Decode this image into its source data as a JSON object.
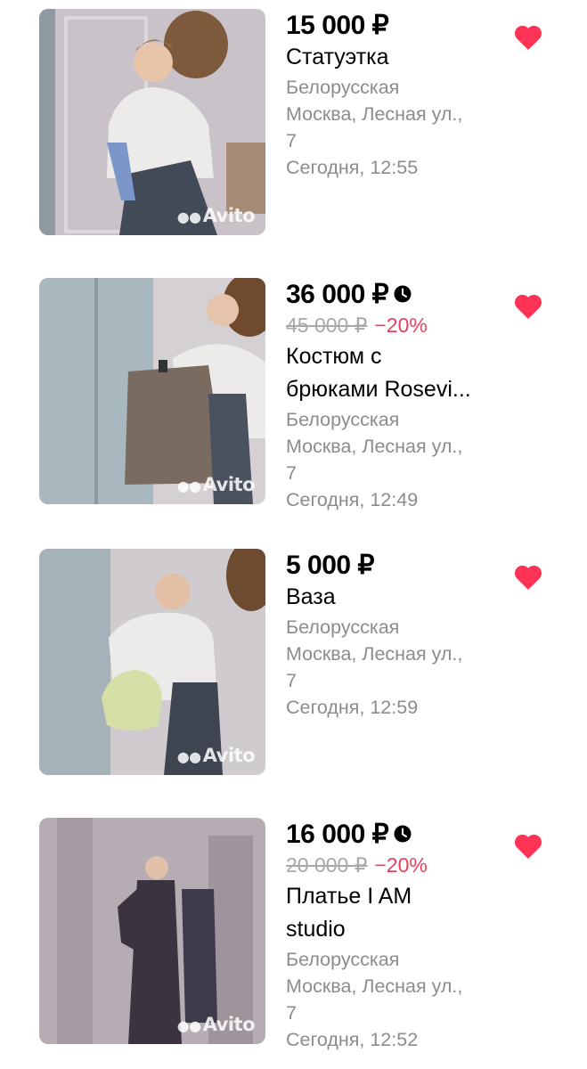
{
  "listings": [
    {
      "price": "15 000 ₽",
      "has_timer": false,
      "old_price": "",
      "discount": "",
      "title_lines": [
        "Статуэтка"
      ],
      "metro": "Белорусская",
      "address_lines": [
        "Москва, Лесная ул.,",
        "7"
      ],
      "date": "Сегодня, 12:55",
      "watermark": "Avito",
      "favorite": true
    },
    {
      "price": "36 000 ₽",
      "has_timer": true,
      "old_price": "45 000 ₽",
      "discount": "−20%",
      "title_lines": [
        "Костюм с",
        "брюками Rosevi..."
      ],
      "metro": "Белорусская",
      "address_lines": [
        "Москва, Лесная ул.,",
        "7"
      ],
      "date": "Сегодня, 12:49",
      "watermark": "Avito",
      "favorite": true
    },
    {
      "price": "5 000 ₽",
      "has_timer": false,
      "old_price": "",
      "discount": "",
      "title_lines": [
        "Ваза"
      ],
      "metro": "Белорусская",
      "address_lines": [
        "Москва, Лесная ул.,",
        "7"
      ],
      "date": "Сегодня, 12:59",
      "watermark": "Avito",
      "favorite": true
    },
    {
      "price": "16 000 ₽",
      "has_timer": true,
      "old_price": "20 000 ₽",
      "discount": "−20%",
      "title_lines": [
        "Платье I AM",
        "studio"
      ],
      "metro": "Белорусская",
      "address_lines": [
        "Москва, Лесная ул.,",
        "7"
      ],
      "date": "Сегодня, 12:52",
      "watermark": "Avito",
      "favorite": true
    }
  ],
  "colors": {
    "favorite": "#ff3355",
    "discount": "#e8405f",
    "meta": "#8c8c8c",
    "old_price": "#a9a9a9"
  }
}
